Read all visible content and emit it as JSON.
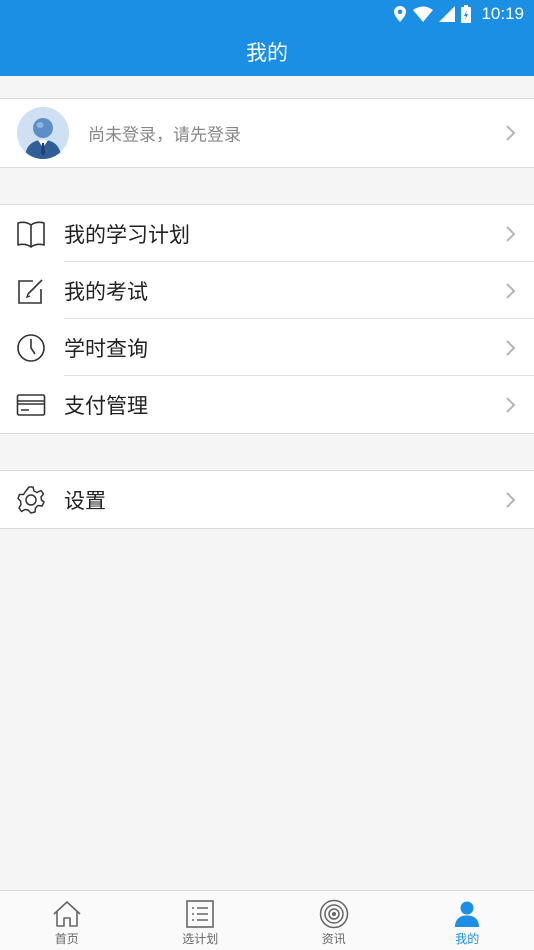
{
  "status_bar": {
    "time": "10:19"
  },
  "header": {
    "title": "我的"
  },
  "profile": {
    "prompt": "尚未登录，请先登录"
  },
  "menu_main": [
    {
      "label": "我的学习计划",
      "icon": "book-icon"
    },
    {
      "label": "我的考试",
      "icon": "edit-icon"
    },
    {
      "label": "学时查询",
      "icon": "clock-icon"
    },
    {
      "label": "支付管理",
      "icon": "card-icon"
    }
  ],
  "menu_settings": {
    "label": "设置",
    "icon": "gear-icon"
  },
  "tabs": [
    {
      "label": "首页",
      "icon": "home-icon",
      "active": false
    },
    {
      "label": "选计划",
      "icon": "list-icon",
      "active": false
    },
    {
      "label": "资讯",
      "icon": "target-icon",
      "active": false
    },
    {
      "label": "我的",
      "icon": "person-icon",
      "active": true
    }
  ],
  "colors": {
    "accent": "#1a8fe3",
    "background": "#f5f5f5"
  }
}
